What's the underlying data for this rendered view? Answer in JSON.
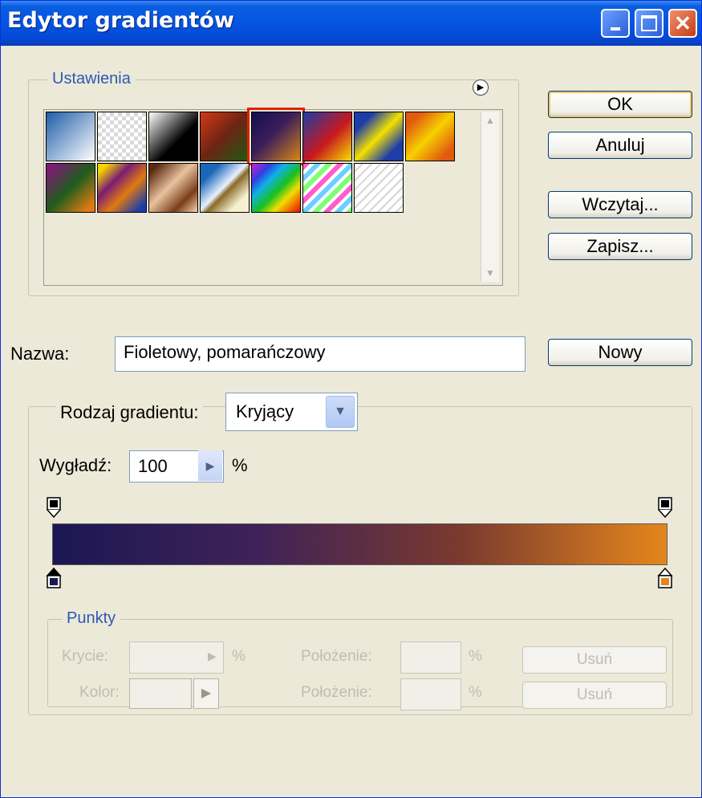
{
  "window": {
    "title": "Edytor gradientów"
  },
  "presets": {
    "label": "Ustawienia",
    "swatches": [
      {
        "name": "swatch-foreground-background",
        "bg": "linear-gradient(135deg,#1d5da8 0%,#ffffff 100%)"
      },
      {
        "name": "swatch-foreground-transparent",
        "bg": "repeating-conic-gradient(#d9d9d9 0% 25%,#ffffff 0% 50%) 0 0/10px 10px"
      },
      {
        "name": "swatch-black-white",
        "bg": "linear-gradient(135deg,#ffffff 0%,#000000 60%)"
      },
      {
        "name": "swatch-red-green",
        "bg": "linear-gradient(135deg,#d43a16 0%,#6b2413 50%,#1c5c12 100%)"
      },
      {
        "name": "swatch-violet-orange",
        "bg": "linear-gradient(135deg,#140f4f 0%,#3b1f5a 45%,#d88716 100%)",
        "selected": true
      },
      {
        "name": "swatch-blue-red-yellow",
        "bg": "linear-gradient(135deg,#1d3da8 0%,#c8181e 55%,#f4e100 100%)"
      },
      {
        "name": "swatch-blue-yellow-blue",
        "bg": "linear-gradient(135deg,#1d3da8 20%,#f4e100 50%,#1d3da8 80%)"
      },
      {
        "name": "swatch-orange-yellow-orange",
        "bg": "linear-gradient(135deg,#e05a10 15%,#f7d000 50%,#e05a10 85%)"
      },
      {
        "name": "swatch-violet-green-orange",
        "bg": "linear-gradient(135deg,#7b1c74 10%,#1f5d1c 50%,#e07a12 90%)"
      },
      {
        "name": "swatch-yellow-violet-orange-blue",
        "bg": "linear-gradient(135deg,#f5d500 10%,#7b1c74 35%,#e07a12 60%,#1d3da8 90%)"
      },
      {
        "name": "swatch-copper",
        "bg": "linear-gradient(135deg,#5b2b10 10%,#e9c2a0 45%,#7a3e1a 75%,#f4d2b4 100%)"
      },
      {
        "name": "swatch-chrome",
        "bg": "linear-gradient(135deg,#1a66b8 20%,#e8f2ff 48%,#8a6b2a 56%,#f6f0d0 80%)"
      },
      {
        "name": "swatch-spectrum",
        "bg": "linear-gradient(135deg,#d21ad0 0%,#3140e0 20%,#10b0e8 35%,#18c020 55%,#f0e000 72%,#f06000 88%,#e01010 100%)"
      },
      {
        "name": "swatch-transparent-rainbow",
        "bg": "repeating-linear-gradient(135deg,#ff5cc8 0 6px,#ffffff 6px 10px,#6ad0ff 10px 16px,#ffffff 16px 20px,#7cff70 20px 26px,#ffffff 26px 30px)"
      },
      {
        "name": "swatch-transparent-stripes",
        "bg": "repeating-linear-gradient(135deg,#ffffff 0 6px,#d5d5d5 6px 8px)"
      }
    ]
  },
  "buttons": {
    "ok": "OK",
    "cancel": "Anuluj",
    "load": "Wczytaj...",
    "save": "Zapisz...",
    "new": "Nowy"
  },
  "name_field": {
    "label": "Nazwa:",
    "value": "Fioletowy, pomarańczowy"
  },
  "gradient": {
    "type_label": "Rodzaj gradientu:",
    "type_value": "Kryjący",
    "smoothness_label": "Wygładź:",
    "smoothness_value": "100",
    "smoothness_unit": "%",
    "bar_colors": [
      "#1b1752",
      "#3f2258",
      "#7a3a2e",
      "#e5861c"
    ],
    "left_color": "#1b1752",
    "right_color": "#e5861c"
  },
  "stops": {
    "label": "Punkty",
    "opacity_label": "Krycie:",
    "opacity_unit": "%",
    "location_label_1": "Położenie:",
    "location_unit_1": "%",
    "delete_1": "Usuń",
    "color_label": "Kolor:",
    "location_label_2": "Położenie:",
    "location_unit_2": "%",
    "delete_2": "Usuń"
  }
}
